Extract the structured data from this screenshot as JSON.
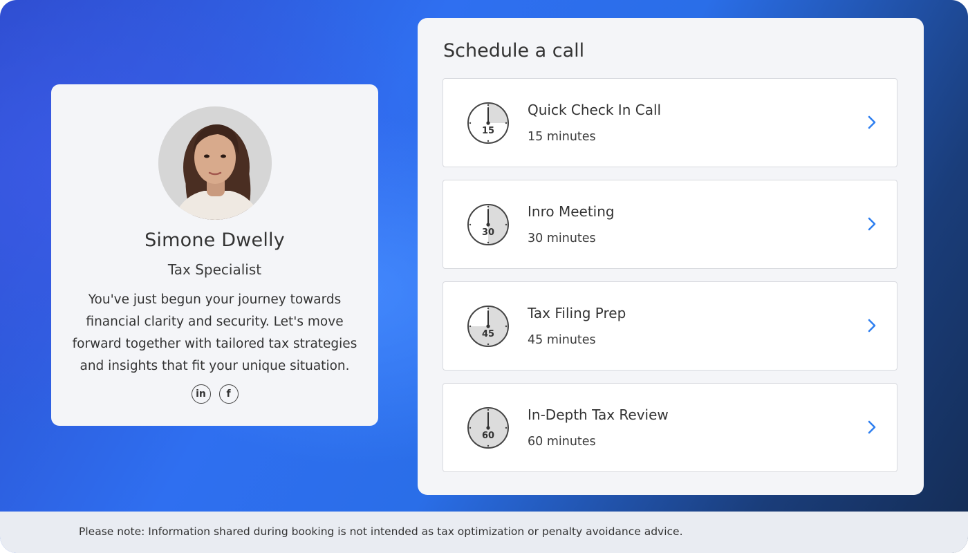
{
  "profile": {
    "name": "Simone Dwelly",
    "title": "Tax Specialist",
    "bio": "You've just begun your journey towards financial clarity and security. Let's move forward together with tailored tax strategies and insights that fit your unique situation.",
    "socials": [
      {
        "icon": "linkedin-icon",
        "label": "in"
      },
      {
        "icon": "facebook-icon",
        "label": "f"
      }
    ]
  },
  "schedule": {
    "title": "Schedule a call",
    "calls": [
      {
        "name": "Quick Check In Call",
        "duration": "15 minutes",
        "clock_label": "15",
        "fraction": 0.25
      },
      {
        "name": "Inro Meeting",
        "duration": "30 minutes",
        "clock_label": "30",
        "fraction": 0.5
      },
      {
        "name": "Tax Filing Prep",
        "duration": "45 minutes",
        "clock_label": "45",
        "fraction": 0.75
      },
      {
        "name": "In-Depth Tax Review",
        "duration": "60 minutes",
        "clock_label": "60",
        "fraction": 1.0
      }
    ]
  },
  "footer": {
    "note": "Please note: Information shared during booking is not intended as tax optimization or penalty avoidance advice."
  },
  "colors": {
    "accent": "#2f7ff0",
    "card_bg": "#f4f5f8",
    "clock_fill": "#dcdcdc"
  }
}
